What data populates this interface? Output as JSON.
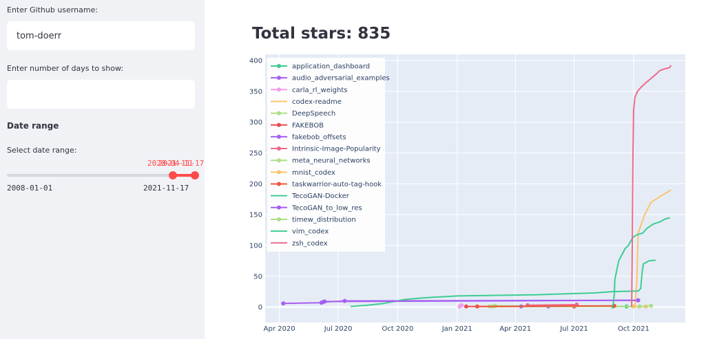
{
  "sidebar": {
    "username_label": "Enter Github username:",
    "username_value": "tom-doerr",
    "days_label": "Enter number of days to show:",
    "days_value": "",
    "date_range_header": "Date range",
    "slider_label": "Select date range:",
    "slider_min": "2008-01-01",
    "slider_max": "2021-11-17",
    "thumb_low_value": "2020-04-11",
    "thumb_high_value": "2021-11-17"
  },
  "main": {
    "title": "Total stars: 835"
  },
  "colors": {
    "accent": "#ff4b4b",
    "sidebar_bg": "#f0f2f6",
    "plot_bg": "#e5ecf6"
  },
  "chart_data": {
    "type": "line",
    "title": "",
    "xlabel": "",
    "ylabel": "",
    "xlim": [
      "2020-03-10",
      "2021-12-20"
    ],
    "ylim": [
      -25,
      410
    ],
    "x_ticks": [
      "Apr 2020",
      "Jul 2020",
      "Oct 2020",
      "Jan 2021",
      "Apr 2021",
      "Jul 2021",
      "Oct 2021"
    ],
    "y_ticks": [
      0,
      50,
      100,
      150,
      200,
      250,
      300,
      350,
      400
    ],
    "grid": true,
    "legend_position": "top-left",
    "series": [
      {
        "name": "application_dashboard",
        "color": "#3dcc91",
        "markers": true,
        "points": [
          [
            "2021-08-30",
            1
          ],
          [
            "2021-09-20",
            1
          ]
        ]
      },
      {
        "name": "audio_adversarial_examples",
        "color": "#a65ef0",
        "markers": true,
        "points": [
          [
            "2020-04-07",
            6
          ],
          [
            "2020-06-05",
            7
          ],
          [
            "2020-06-07",
            8
          ],
          [
            "2020-07-11",
            10
          ],
          [
            "2021-10-08",
            11
          ]
        ]
      },
      {
        "name": "carla_rl_weights",
        "color": "#f39bef",
        "markers": true,
        "points": [
          [
            "2021-01-05",
            1
          ],
          [
            "2021-01-06",
            2
          ],
          [
            "2021-01-08",
            3
          ]
        ]
      },
      {
        "name": "codex-readme",
        "color": "#f9c56b",
        "markers": false,
        "points": [
          [
            "2021-10-03",
            0
          ],
          [
            "2021-10-06",
            40
          ],
          [
            "2021-10-08",
            120
          ],
          [
            "2021-10-18",
            150
          ],
          [
            "2021-10-28",
            170
          ],
          [
            "2021-11-12",
            180
          ],
          [
            "2021-11-28",
            190
          ]
        ]
      },
      {
        "name": "DeepSpeech",
        "color": "#aede86",
        "markers": true,
        "points": [
          [
            "2021-02-25",
            1
          ],
          [
            "2021-03-01",
            2
          ],
          [
            "2021-10-10",
            1
          ]
        ]
      },
      {
        "name": "FAKEBOB",
        "color": "#e84d4d",
        "markers": true,
        "points": [
          [
            "2021-01-15",
            1
          ],
          [
            "2021-07-01",
            1
          ]
        ]
      },
      {
        "name": "fakebob_offsets",
        "color": "#a65ef0",
        "markers": true,
        "points": [
          [
            "2021-04-10",
            1
          ],
          [
            "2021-05-22",
            1
          ]
        ]
      },
      {
        "name": "Intrinsic-Image-Popularity",
        "color": "#ef6a8b",
        "markers": true,
        "points": [
          [
            "2021-04-20",
            3
          ],
          [
            "2021-07-05",
            4
          ]
        ]
      },
      {
        "name": "meta_neural_networks",
        "color": "#aede86",
        "markers": true,
        "points": [
          [
            "2021-02-20",
            1
          ],
          [
            "2021-10-10",
            1
          ]
        ]
      },
      {
        "name": "mnist_codex",
        "color": "#f9c56b",
        "markers": true,
        "points": [
          [
            "2021-10-01",
            1
          ],
          [
            "2021-10-20",
            1
          ]
        ]
      },
      {
        "name": "taskwarrior-auto-tag-hook",
        "color": "#ef553b",
        "markers": true,
        "points": [
          [
            "2021-02-01",
            1
          ],
          [
            "2021-09-01",
            2
          ]
        ]
      },
      {
        "name": "TecoGAN-Docker",
        "color": "#3dcc91",
        "markers": false,
        "points": [
          [
            "2020-07-20",
            1
          ],
          [
            "2020-08-15",
            3
          ],
          [
            "2020-09-10",
            6
          ],
          [
            "2020-10-10",
            12
          ],
          [
            "2020-11-10",
            15
          ],
          [
            "2021-01-01",
            18
          ],
          [
            "2021-05-01",
            20
          ],
          [
            "2021-08-01",
            23
          ],
          [
            "2021-08-28",
            25
          ],
          [
            "2021-10-08",
            26
          ],
          [
            "2021-10-12",
            30
          ],
          [
            "2021-10-14",
            55
          ],
          [
            "2021-10-16",
            70
          ],
          [
            "2021-10-25",
            75
          ],
          [
            "2021-11-04",
            76
          ]
        ]
      },
      {
        "name": "TecoGAN_to_low_res",
        "color": "#a65ef0",
        "markers": true,
        "points": [
          [
            "2020-06-10",
            9
          ],
          [
            "2021-10-08",
            11
          ]
        ]
      },
      {
        "name": "timew_distribution",
        "color": "#aede86",
        "markers": true,
        "points": [
          [
            "2021-10-10",
            1
          ],
          [
            "2021-10-28",
            2
          ]
        ]
      },
      {
        "name": "vim_codex",
        "color": "#3dcc91",
        "markers": false,
        "points": [
          [
            "2021-08-30",
            1
          ],
          [
            "2021-09-01",
            20
          ],
          [
            "2021-09-02",
            45
          ],
          [
            "2021-09-05",
            60
          ],
          [
            "2021-09-08",
            75
          ],
          [
            "2021-09-13",
            85
          ],
          [
            "2021-09-18",
            95
          ],
          [
            "2021-09-23",
            100
          ],
          [
            "2021-09-28",
            110
          ],
          [
            "2021-10-02",
            115
          ],
          [
            "2021-10-08",
            118
          ],
          [
            "2021-10-15",
            120
          ],
          [
            "2021-10-22",
            128
          ],
          [
            "2021-11-01",
            135
          ],
          [
            "2021-11-10",
            138
          ],
          [
            "2021-11-19",
            143
          ],
          [
            "2021-11-26",
            145
          ]
        ]
      },
      {
        "name": "zsh_codex",
        "color": "#ef6a8b",
        "markers": false,
        "points": [
          [
            "2021-09-28",
            0
          ],
          [
            "2021-09-29",
            100
          ],
          [
            "2021-09-30",
            250
          ],
          [
            "2021-10-01",
            320
          ],
          [
            "2021-10-03",
            340
          ],
          [
            "2021-10-07",
            350
          ],
          [
            "2021-10-12",
            356
          ],
          [
            "2021-10-20",
            364
          ],
          [
            "2021-10-27",
            370
          ],
          [
            "2021-11-05",
            378
          ],
          [
            "2021-11-11",
            384
          ],
          [
            "2021-11-20",
            387
          ],
          [
            "2021-11-25",
            388
          ],
          [
            "2021-11-28",
            392
          ]
        ]
      }
    ]
  }
}
